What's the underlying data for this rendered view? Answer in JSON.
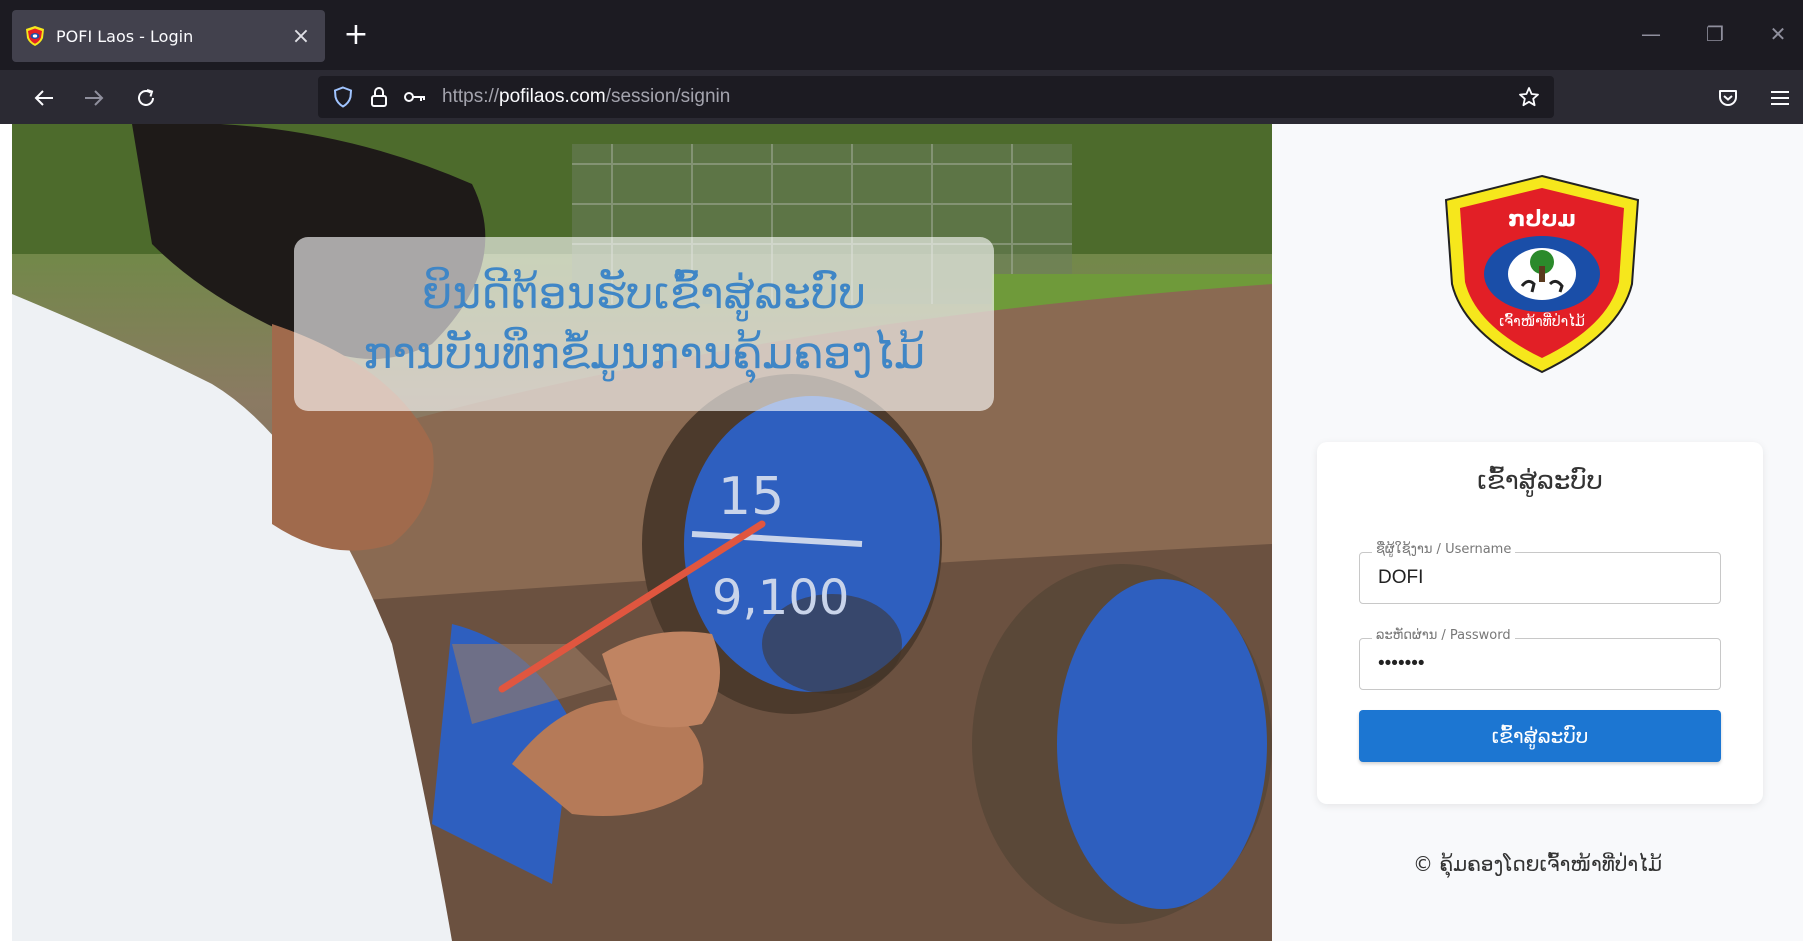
{
  "browser": {
    "tab_title": "POFI Laos - Login",
    "tab_close": "×",
    "new_tab": "+",
    "url_prefix": "https://",
    "url_domain": "pofilaos.com",
    "url_path": "/session/signin",
    "window_controls": {
      "minimize": "—",
      "restore": "❐",
      "close": "✕"
    },
    "accent": "#1c1b22"
  },
  "hero": {
    "welcome_line1": "ຍິນດີຕ້ອນຮັບເຂົ້າສູ່ລະບົບ",
    "welcome_line2": "ການບັນທຶກຂໍ້ມູນການຄຸ້ມຄອງໄມ້",
    "welcome_color": "#3f86c6",
    "log_markings": {
      "top": "15",
      "bottom": "9,100"
    }
  },
  "logo": {
    "icon": "shield-emblem-icon",
    "top_text": "ກປບມ",
    "bottom_text": "ເຈົ້າໜ້າທີ່ປ່າໄມ້",
    "colors": {
      "outer": "#f6e71c",
      "inner": "#e21f26",
      "oval": "#1a4ea8"
    }
  },
  "login": {
    "title": "ເຂົ້າສູ່ລະບົບ",
    "username_label": "ຊື່ຜູ້ໃຊ້ງານ / Username",
    "username_value": "DOFI",
    "password_label": "ລະຫັດຜ່ານ / Password",
    "password_value": "•••••••",
    "submit_label": "ເຂົ້າສູ່ລະບົບ",
    "button_color": "#1c76d2"
  },
  "footer": {
    "copyright": "© ຄຸ້ມຄອງໂດຍເຈົ້າໜ້າທີ່ປ່າໄມ້"
  }
}
